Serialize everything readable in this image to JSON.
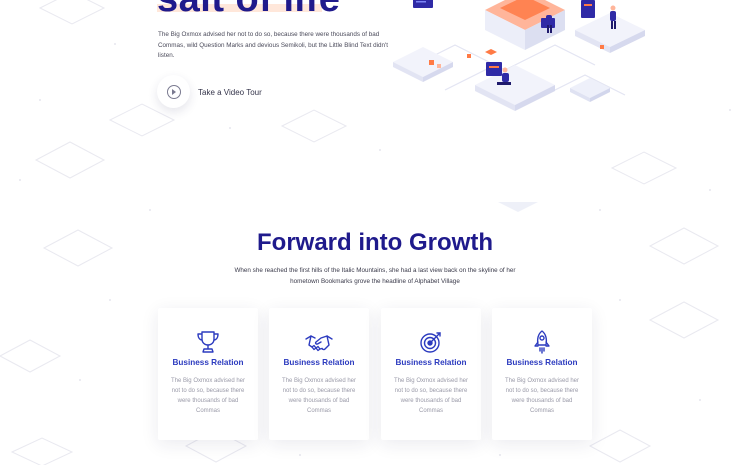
{
  "hero": {
    "title": "salt of life",
    "description": "The Big Oxmox advised her not to do so, because there were thousands of bad Commas, wild Question Marks and devious Semikoli, but the Little Blind Text didn't listen.",
    "video_label": "Take a Video Tour"
  },
  "section": {
    "title": "Forward into Growth",
    "subtitle": "When she reached the first hills of the Italic Mountains, she had a last view back on the skyline of her hometown Bookmarks grove the headline of Alphabet Village"
  },
  "cards": [
    {
      "icon": "trophy-icon",
      "title": "Business Relation",
      "text": "The Big Oxmox advised her not to do so, because there were thousands of bad Commas"
    },
    {
      "icon": "handshake-icon",
      "title": "Business Relation",
      "text": "The Big Oxmox advised her not to do so, because there were thousands of bad Commas"
    },
    {
      "icon": "target-icon",
      "title": "Business Relation",
      "text": "The Big Oxmox advised her not to do so, because there were thousands of bad Commas"
    },
    {
      "icon": "rocket-icon",
      "title": "Business Relation",
      "text": "The Big Oxmox advised her not to do so, because there were thousands of bad Commas"
    }
  ],
  "colors": {
    "heading": "#1f1a8c",
    "card_title": "#2c3bbf",
    "muted_text": "#9a9aa8",
    "accent_orange": "#ff7a45"
  }
}
